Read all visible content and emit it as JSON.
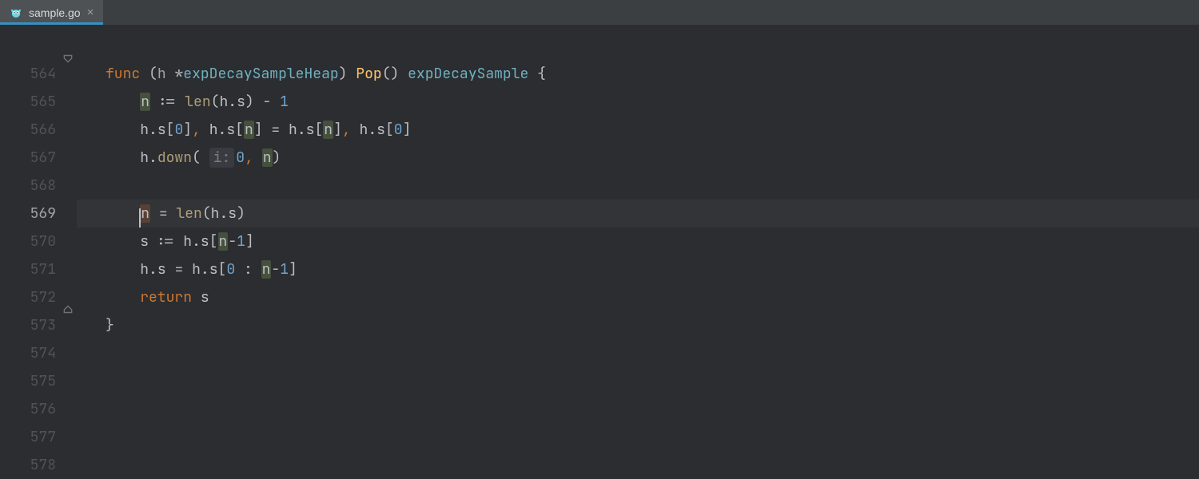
{
  "tab": {
    "filename": "sample.go",
    "close_glyph": "×",
    "active": true
  },
  "gutter": {
    "lines": [
      "",
      "564",
      "565",
      "566",
      "567",
      "568",
      "569",
      "570",
      "571",
      "572",
      "573",
      "574",
      "575",
      "576",
      "577",
      "578"
    ],
    "current_line": "569",
    "fold_top_line": "564",
    "fold_bottom_line": "573"
  },
  "code": {
    "inlay_hint_label": "i:",
    "lines": {
      "l564": {
        "kw_func": "func",
        "recv": "(h *expDecaySampleHeap)",
        "fn": "Pop",
        "ret_type": "expDecaySample",
        "brace": "{"
      },
      "l565": {
        "lhs": "n",
        "op": ":=",
        "call": "len",
        "arg": "h.s",
        "minus": "−",
        "one": "1"
      },
      "l566": {
        "a": "h.s[0]",
        "b": "h.s[n]",
        "eq": "=",
        "c": "h.s[n]",
        "d": "h.s[0]"
      },
      "l567": {
        "obj": "h",
        "method": "down",
        "zero": "0",
        "arg2": "n"
      },
      "l569": {
        "lhs": "n",
        "eq": "=",
        "call": "len",
        "arg": "h.s"
      },
      "l570": {
        "lhs": "s",
        "op": ":=",
        "rhs": "h.s[n−1]"
      },
      "l571": {
        "lhs": "h.s",
        "eq": "=",
        "rhs": "h.s[0 : n−1]"
      },
      "l572": {
        "kw": "return",
        "val": "s"
      },
      "l573": {
        "brace": "}"
      }
    }
  }
}
